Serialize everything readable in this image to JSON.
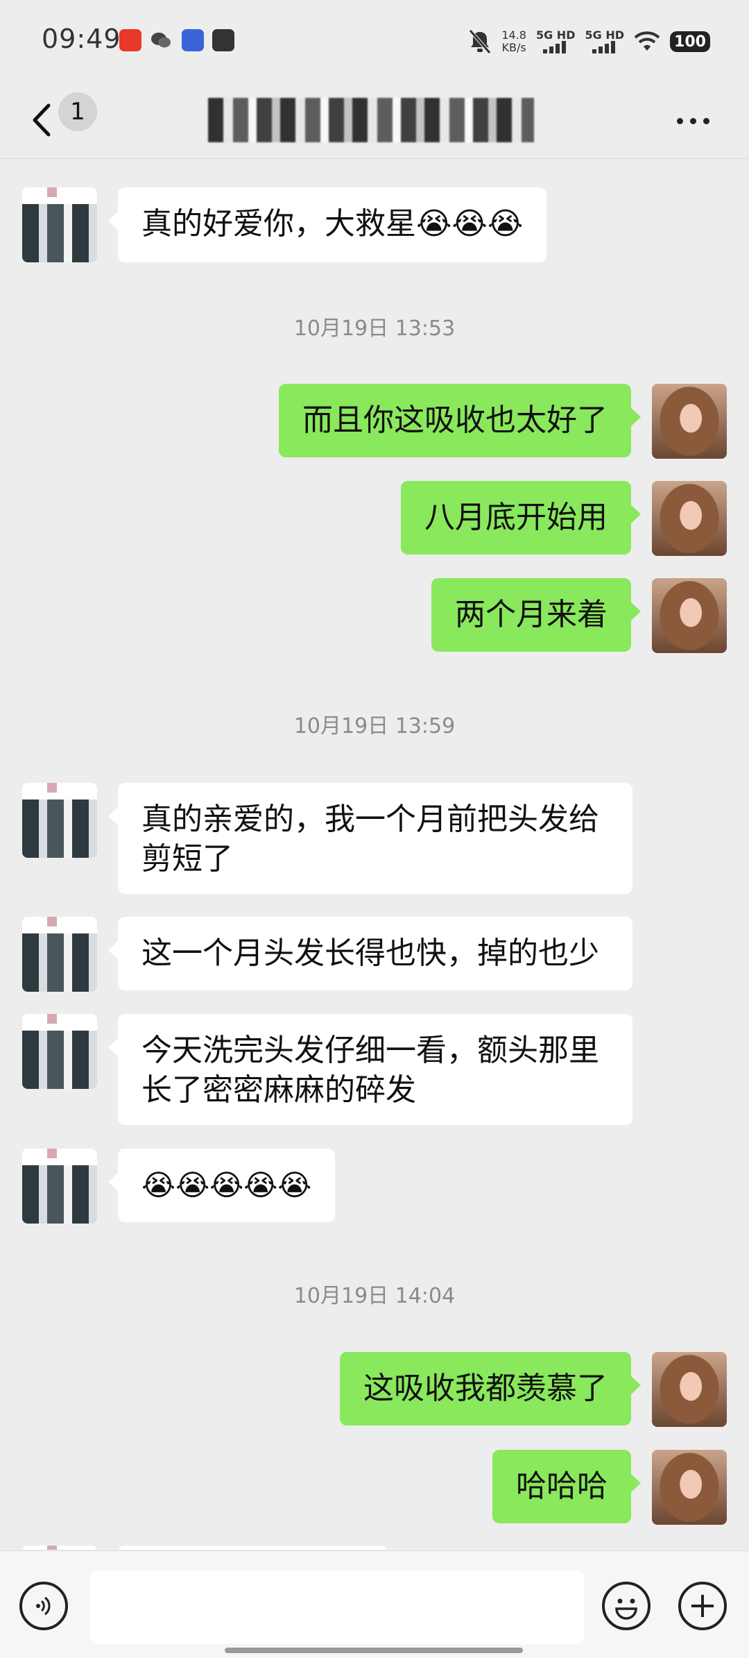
{
  "status_bar": {
    "time": "09:49",
    "speed_value": "14.8",
    "speed_unit": "KB/s",
    "net1": "5G HD",
    "net2": "5G HD",
    "battery": "100",
    "icons": [
      "taobao-icon",
      "wechat-icon",
      "baidu-icon",
      "message-icon",
      "mute-icon",
      "wifi-icon"
    ]
  },
  "nav": {
    "unread_count": "1",
    "title": ""
  },
  "chat": {
    "messages": [
      {
        "type": "in",
        "text": "真的好爱你，大救星😭😭😭"
      },
      {
        "type": "time",
        "text": "10月19日 13:53"
      },
      {
        "type": "out",
        "text": "而且你这吸收也太好了"
      },
      {
        "type": "out",
        "text": "八月底开始用"
      },
      {
        "type": "out",
        "text": "两个月来着"
      },
      {
        "type": "time",
        "text": "10月19日 13:59"
      },
      {
        "type": "in",
        "text": "真的亲爱的，我一个月前把头发给\n剪短了"
      },
      {
        "type": "in",
        "text": "这一个月头发长得也快，掉的也少"
      },
      {
        "type": "in",
        "text": "今天洗完头发仔细一看，额头那里\n长了密密麻麻的碎发"
      },
      {
        "type": "in",
        "text": "😭😭😭😭😭"
      },
      {
        "type": "time",
        "text": "10月19日 14:04"
      },
      {
        "type": "out",
        "text": "这吸收我都羡慕了"
      },
      {
        "type": "out",
        "text": "哈哈哈"
      }
    ]
  },
  "colors": {
    "background": "#ededed",
    "outgoing_bubble": "#89e85c",
    "incoming_bubble": "#ffffff",
    "timestamp": "#8a8a8a"
  }
}
